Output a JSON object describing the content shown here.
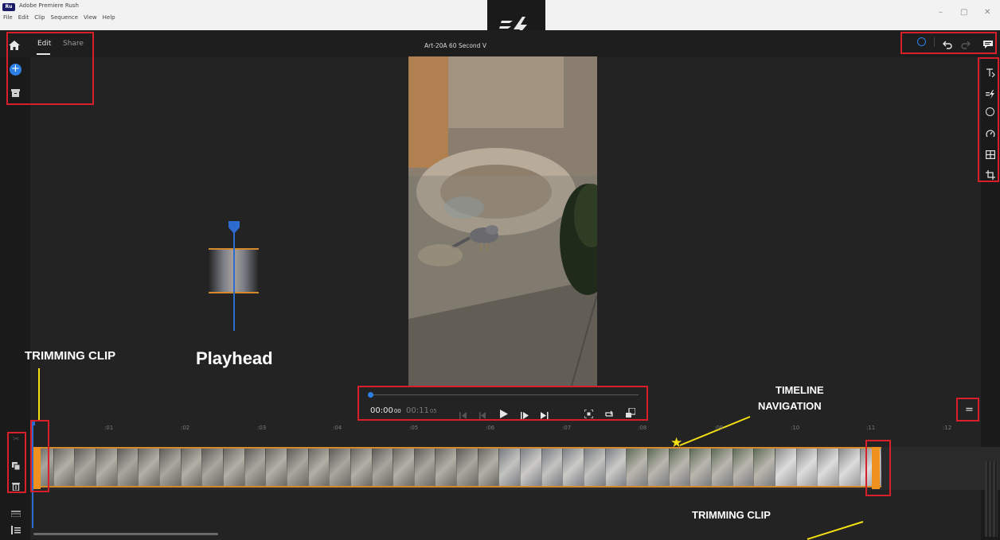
{
  "window": {
    "title": "Adobe Premiere Rush",
    "app_badge": "Ru",
    "minimize": "–",
    "maximize": "▢",
    "close": "✕"
  },
  "menu": [
    "File",
    "Edit",
    "Clip",
    "Sequence",
    "View",
    "Help"
  ],
  "tabs": {
    "edit": "Edit",
    "share": "Share"
  },
  "project_title": "Art-20A 60 Second V",
  "playback": {
    "current_time": "00:00",
    "current_frames": "00",
    "total_time": "00:11",
    "total_frames": "05"
  },
  "ruler": [
    ":01",
    ":02",
    ":03",
    ":04",
    ":05",
    ":06",
    ":07",
    ":08",
    ":09",
    ":10",
    ":11",
    ":12"
  ],
  "annotations": {
    "trimming_clip_left": "TRIMMING CLIP",
    "playhead": "Playhead",
    "timeline_nav_1": "TIMELINE",
    "timeline_nav_2": "NAVIGATION",
    "trimming_clip_right": "TRIMMING CLIP"
  },
  "icons": {
    "home": "home-icon",
    "add": "add-media-icon",
    "project": "project-archive-icon",
    "logo": "premiere-rush-logo-icon",
    "undo": "undo-icon",
    "redo": "redo-icon",
    "feedback": "feedback-icon",
    "titles": "titles-icon",
    "transitions": "transitions-icon",
    "color": "color-icon",
    "speed": "speed-icon",
    "transform": "transform-icon",
    "crop": "crop-icon"
  },
  "colors": {
    "accent": "#2d7fe6",
    "highlight_box": "#d9202a",
    "trim_handle": "#f0901e",
    "annotation_line": "#f4e012"
  }
}
